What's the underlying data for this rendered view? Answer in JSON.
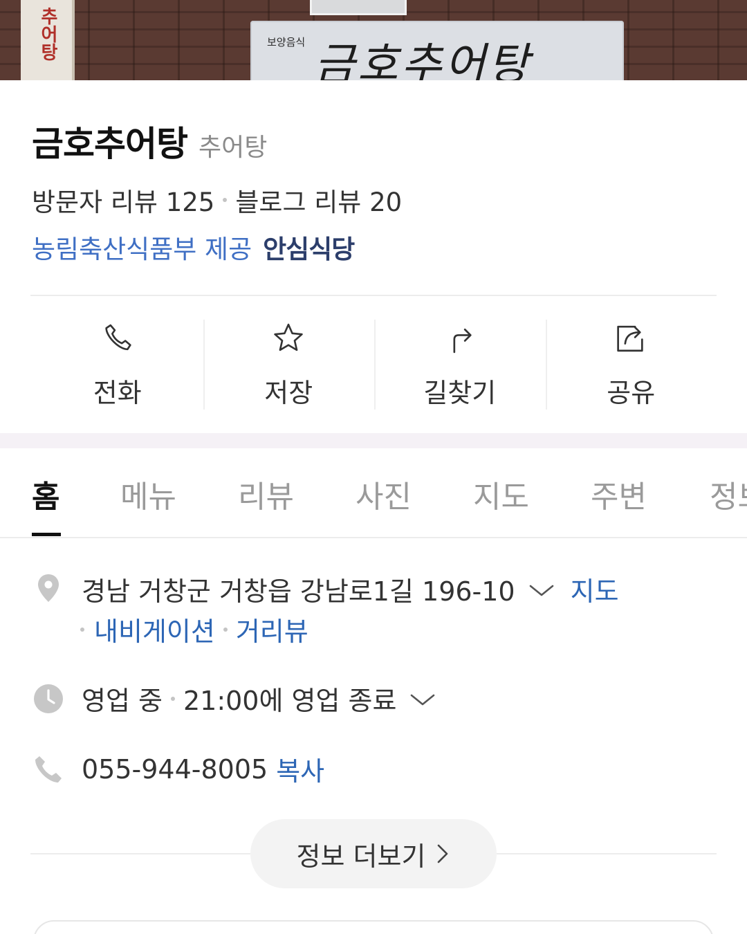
{
  "hero": {
    "sign_small": "보양음식",
    "sign_big": "금호추어탕",
    "side_sign": "추어탕"
  },
  "place": {
    "name": "금호추어탕",
    "category": "추어탕",
    "visitor_review_label": "방문자 리뷰 125",
    "blog_review_label": "블로그 리뷰 20",
    "certification_provider": "농림축산식품부 제공",
    "certification_badge": "안심식당"
  },
  "actions": [
    {
      "label": "전화",
      "icon": "phone-icon"
    },
    {
      "label": "저장",
      "icon": "star-icon"
    },
    {
      "label": "길찾기",
      "icon": "directions-icon"
    },
    {
      "label": "공유",
      "icon": "share-icon"
    }
  ],
  "tabs": [
    {
      "label": "홈",
      "active": true
    },
    {
      "label": "메뉴"
    },
    {
      "label": "리뷰"
    },
    {
      "label": "사진"
    },
    {
      "label": "지도"
    },
    {
      "label": "주변"
    },
    {
      "label": "정보"
    }
  ],
  "info": {
    "address": "경남 거창군 거창읍 강남로1길 196-10",
    "map_link": "지도",
    "navigation_link": "내비게이션",
    "streetview_link": "거리뷰",
    "status": "영업 중",
    "hours": "21:00에 영업 종료",
    "phone": "055-944-8005",
    "copy_link": "복사",
    "more_button": "정보 더보기"
  },
  "colors": {
    "link_blue": "#2d66b5",
    "cert_blue": "#3f6fc4",
    "badge_navy": "#2c3e6b",
    "band": "#f5f1f6"
  }
}
